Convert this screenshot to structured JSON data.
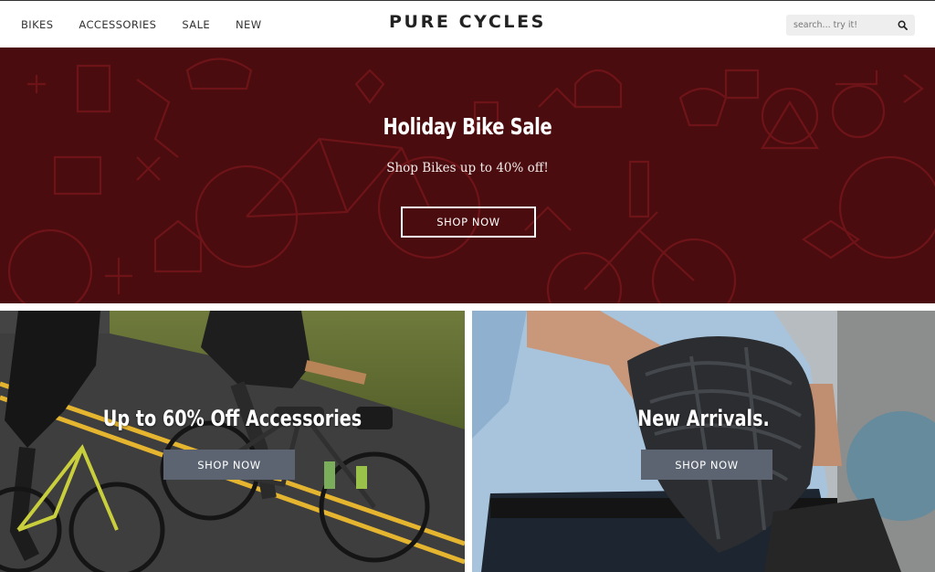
{
  "header": {
    "nav": [
      "BIKES",
      "ACCESSORIES",
      "SALE",
      "NEW"
    ],
    "logo": "PURE CYCLES",
    "search_placeholder": "search... try it!",
    "search_icon": "magnifier-icon"
  },
  "hero": {
    "title": "Holiday Bike Sale",
    "subtitle": "Shop Bikes up to 40% off!",
    "button": "SHOP NOW",
    "background_color": "#4a0c0e",
    "pattern_color": "#6e1418"
  },
  "promos": [
    {
      "title": "Up to 60% Off Accessories",
      "button": "SHOP NOW"
    },
    {
      "title": "New Arrivals.",
      "button": "SHOP NOW"
    }
  ],
  "colors": {
    "button_gray": "#5b6470",
    "text_dark": "#222222"
  }
}
